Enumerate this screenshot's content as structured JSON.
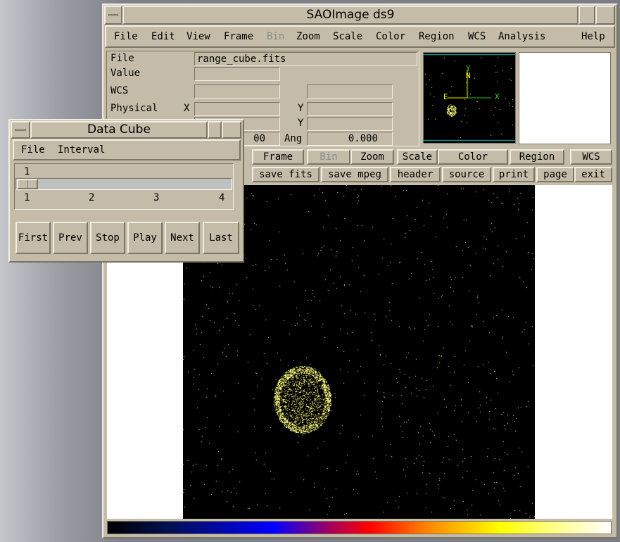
{
  "main": {
    "title": "SAOImage ds9",
    "menu": [
      "File",
      "Edit",
      "View",
      "Frame",
      "Bin",
      "Zoom",
      "Scale",
      "Color",
      "Region",
      "WCS",
      "Analysis",
      "Help"
    ],
    "info": {
      "file_label": "File",
      "file_value": "range_cube.fits",
      "value_label": "Value",
      "wcs_label": "WCS",
      "physical_label": "Physical",
      "x_label": "X",
      "y_label": "Y",
      "y2_label": "Y",
      "zoom_partial": "00",
      "ang_label": "Ang",
      "ang_value": "0.000"
    },
    "compass": {
      "n": "N",
      "e": "E",
      "x": "X",
      "y": "Y"
    },
    "buttons_row1": [
      "Frame",
      "Bin",
      "Zoom",
      "Scale",
      "Color",
      "Region",
      "WCS"
    ],
    "buttons_row2": [
      "save fits",
      "save mpeg",
      "header",
      "source",
      "print",
      "page",
      "exit"
    ]
  },
  "cube": {
    "title": "Data Cube",
    "menu": [
      "File",
      "Interval"
    ],
    "slider": {
      "value": 1,
      "min": 1,
      "max": 4,
      "ticks": [
        "1",
        "2",
        "3",
        "4"
      ],
      "current_label": "1"
    },
    "buttons": [
      "First",
      "Prev",
      "Stop",
      "Play",
      "Next",
      "Last"
    ]
  },
  "colors": {
    "panel": "#c4bca8",
    "image_bg": "#000000",
    "points": "#ffff80"
  }
}
